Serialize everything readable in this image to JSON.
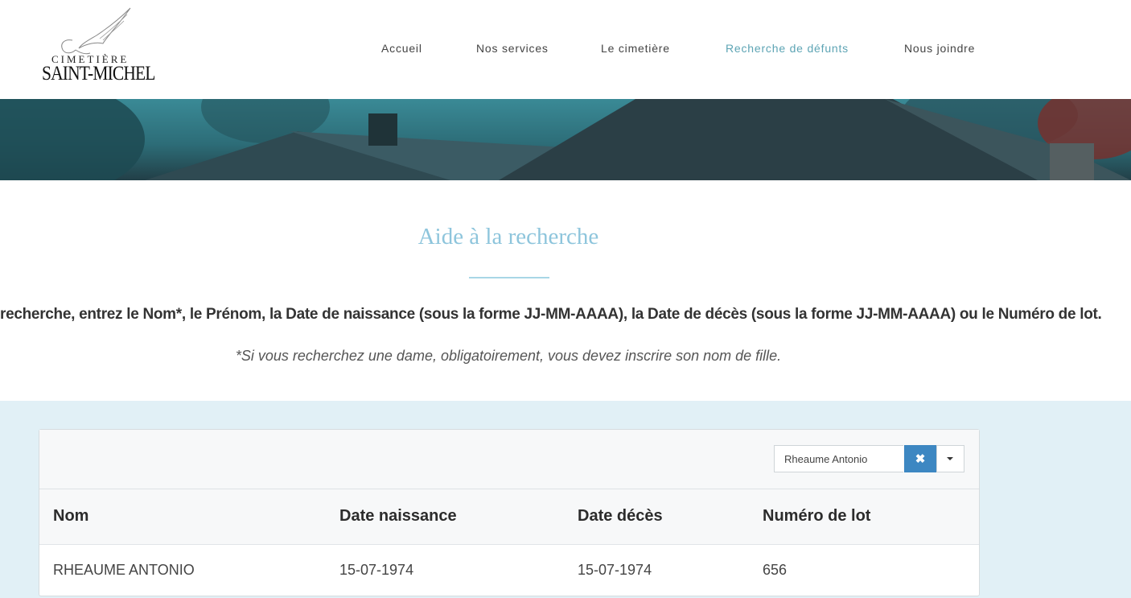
{
  "header": {
    "logo": {
      "top_text": "CIMETIÈRE",
      "name": "SAINT-MICHEL"
    },
    "nav": [
      {
        "label": "Accueil"
      },
      {
        "label": "Nos services"
      },
      {
        "label": "Le cimetière"
      },
      {
        "label": "Recherche de défunts",
        "active": true
      },
      {
        "label": "Nous joindre"
      }
    ],
    "active_color": "#5da4b4"
  },
  "intro": {
    "title": "Aide à la recherche",
    "instructions": "recherche, entrez le Nom*, le Prénom, la Date de naissance (sous la forme JJ-MM-AAAA), la Date de décès (sous la forme JJ-MM-AAAA) ou le Numéro de lot.",
    "note": "*Si vous recherchez une dame, obligatoirement, vous devez inscrire son nom de fille."
  },
  "search": {
    "value": "Rheaume Antonio",
    "clear_icon": "✖",
    "accent": "#3d87c2"
  },
  "table": {
    "columns": [
      "Nom",
      "Date naissance",
      "Date décès",
      "Numéro de lot"
    ],
    "rows": [
      [
        "RHEAUME ANTONIO",
        "15-07-1974",
        "15-07-1974",
        "656"
      ]
    ]
  }
}
